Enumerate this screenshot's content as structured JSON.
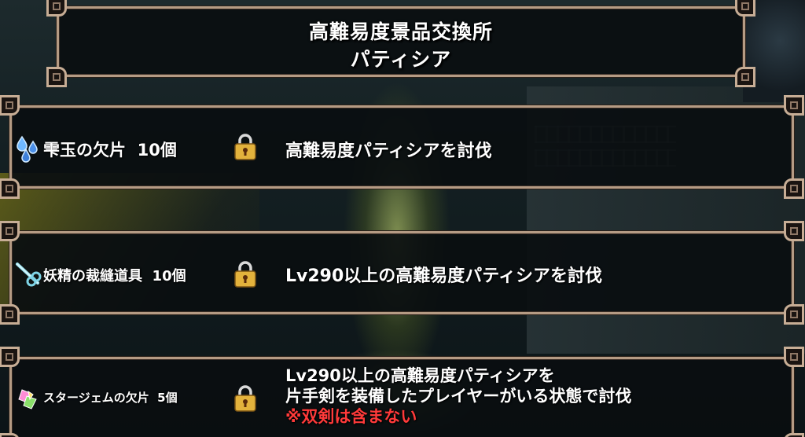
{
  "header": {
    "title_line1": "高難易度景品交換所",
    "title_line2": "パティシア"
  },
  "rewards": [
    {
      "icon": "water-drop-shards-icon",
      "item": "雫玉の欠片",
      "quantity": "10個",
      "locked": true,
      "condition": [
        "高難易度パティシアを討伐"
      ]
    },
    {
      "icon": "sewing-tool-icon",
      "item": "妖精の裁縫道具",
      "quantity": "10個",
      "locked": true,
      "condition": [
        "Lv290以上の高難易度パティシアを討伐"
      ]
    },
    {
      "icon": "star-gem-shard-icon",
      "item": "スタージェムの欠片",
      "quantity": "5個",
      "locked": true,
      "condition": [
        "Lv290以上の高難易度パティシアを",
        "片手剣を装備したプレイヤーがいる状態で討伐"
      ],
      "note": "※双剣は含まない"
    }
  ],
  "colors": {
    "frame": "#b59b84",
    "note": "#ff3a3a",
    "lock_gold": "#e3b23c"
  }
}
